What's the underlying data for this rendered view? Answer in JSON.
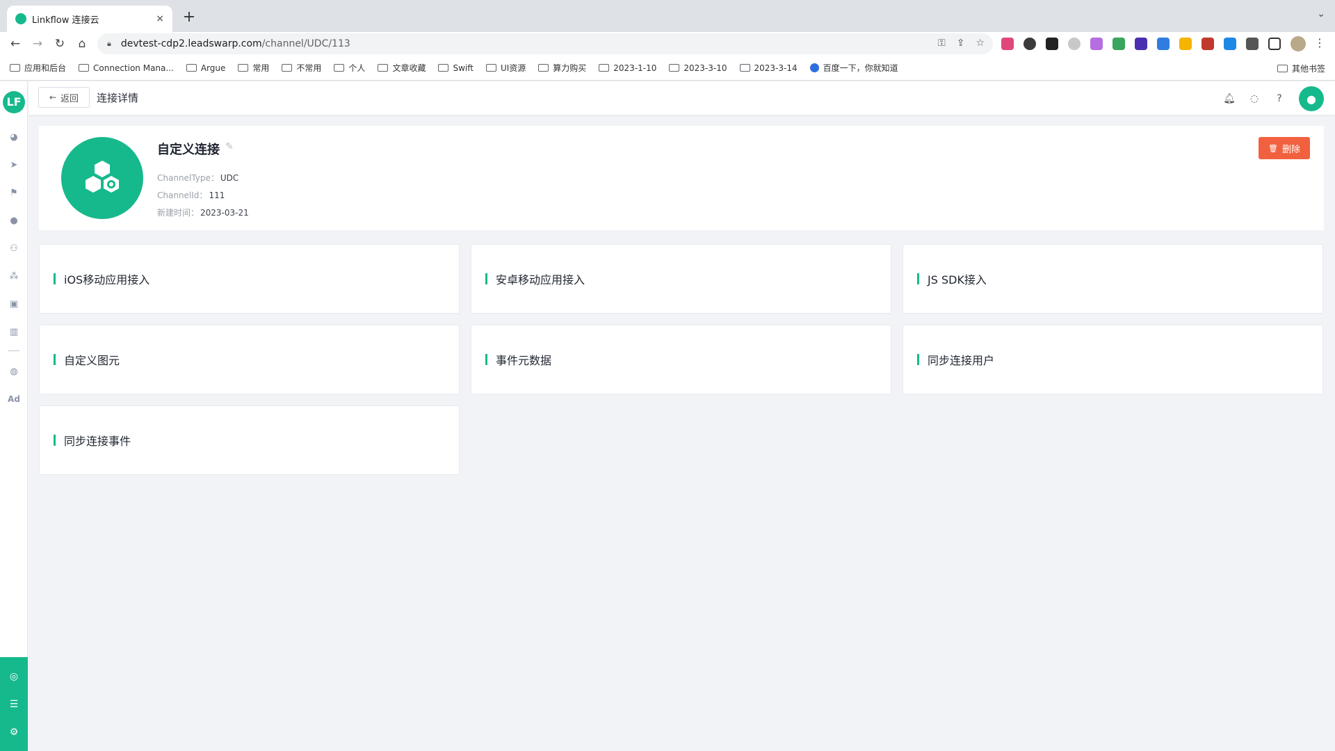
{
  "browser": {
    "tab_title": "Linkflow 连接云",
    "tab_close": "×",
    "new_tab": "+",
    "url_host": "devtest-cdp2.leadswarp.com",
    "url_path": "/channel/UDC/113",
    "bookmarks": [
      "应用和后台",
      "Connection Mana...",
      "Argue",
      "常用",
      "不常用",
      "个人",
      "文章收藏",
      "Swift",
      "UI资源",
      "算力购买",
      "2023-1-10",
      "2023-3-10",
      "2023-3-14",
      "百度一下，你就知道"
    ],
    "other_bookmarks": "其他书签"
  },
  "sidebar": {
    "logo_text": "LF",
    "items": [
      "dashboard-icon",
      "send-icon",
      "flag-icon",
      "user-icon",
      "users-icon",
      "segments-icon",
      "bookmark-icon",
      "bar-chart-icon",
      "wechat-icon",
      "ad-icon"
    ],
    "ad_label": "Ad",
    "bottom_items": [
      "connect-icon",
      "data-icon",
      "settings-icon"
    ]
  },
  "header": {
    "back_label": "返回",
    "title": "连接详情"
  },
  "connection": {
    "name": "自定义连接",
    "channel_type_label": "ChannelType：",
    "channel_type": "UDC",
    "channel_id_label": "ChannelId：",
    "channel_id": "111",
    "created_label": "新建时间：",
    "created": "2023-03-21",
    "delete_label": "删除"
  },
  "cards": [
    "iOS移动应用接入",
    "安卓移动应用接入",
    "JS SDK接入",
    "自定义图元",
    "事件元数据",
    "同步连接用户",
    "同步连接事件"
  ],
  "colors": {
    "brand": "#16b98c",
    "danger": "#f2613f"
  }
}
